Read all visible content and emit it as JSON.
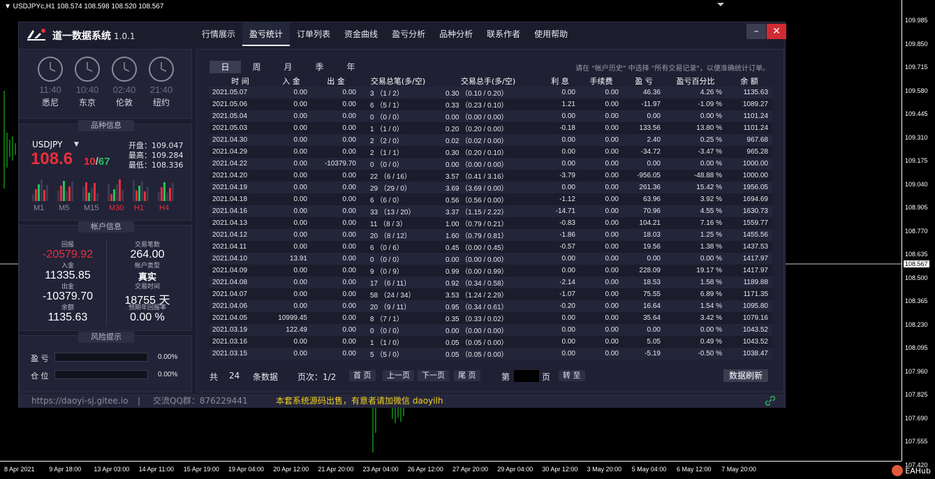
{
  "chart": {
    "symbol": "▼ USDJPYc,H1  108.574 108.598 108.520 108.567",
    "prices": [
      "109.985",
      "109.850",
      "109.715",
      "109.580",
      "109.445",
      "109.310",
      "109.175",
      "109.040",
      "108.905",
      "108.770",
      "108.635",
      "108.500",
      "108.365",
      "108.230",
      "108.095",
      "107.960",
      "107.825",
      "107.690",
      "107.555",
      "107.420"
    ],
    "current_price": "108.567",
    "times": [
      "8 Apr 2021",
      "9 Apr 18:00",
      "13 Apr 03:00",
      "14 Apr 11:00",
      "15 Apr 19:00",
      "19 Apr 04:00",
      "20 Apr 12:00",
      "21 Apr 20:00",
      "23 Apr 04:00",
      "26 Apr 12:00",
      "27 Apr 20:00",
      "29 Apr 04:00",
      "30 Apr 12:00",
      "3 May 20:00",
      "5 May 04:00",
      "6 May 12:00",
      "7 May 20:00"
    ],
    "watermark": "EAHub"
  },
  "app": {
    "title": "道一数据系统",
    "version": "1.0.1",
    "nav": [
      "行情展示",
      "盈亏统计",
      "订单列表",
      "资金曲线",
      "盈亏分析",
      "品种分析",
      "联系作者",
      "使用帮助"
    ],
    "min_label": "–",
    "close_label": "✕"
  },
  "clocks": [
    {
      "time": "11:40",
      "city": "悉尼"
    },
    {
      "time": "10:40",
      "city": "东京"
    },
    {
      "time": "02:40",
      "city": "伦敦"
    },
    {
      "time": "21:40",
      "city": "纽约"
    }
  ],
  "symbol": {
    "section_title": "品种信息",
    "name": "USDJPY",
    "price_main": "108.6",
    "price_frac_a": "10",
    "price_sep": "/",
    "price_frac_b": "67",
    "open": "开盘：109.047",
    "high": "最高：109.284",
    "low": "最低：108.336",
    "timeframes": [
      "M1",
      "M5",
      "M15",
      "M30",
      "H1",
      "H4"
    ]
  },
  "account": {
    "section_title": "帐户信息",
    "return_label": "回报",
    "return_value": "-20579.92",
    "trades_label": "交易笔数",
    "trades_value": "264.00",
    "deposit_label": "入金",
    "deposit_value": "11335.85",
    "type_label": "帐户类型",
    "type_value": "真实",
    "withdraw_label": "出金",
    "withdraw_value": "-10379.70",
    "time_label": "交易时间",
    "time_value": "18755 天",
    "balance_label": "余额",
    "balance_value": "1135.63",
    "annual_label": "预期年回报率",
    "annual_value": "0.00 %"
  },
  "risk": {
    "section_title": "风险提示",
    "pl_label": "盈 亏",
    "pl_value": "0.00%",
    "pos_label": "仓 位",
    "pos_value": "0.00%"
  },
  "stats": {
    "periods": [
      "日",
      "周",
      "月",
      "季",
      "年"
    ],
    "hint": "请在 \"帐户历史\" 中选择 \"所有交易记录\"，以便准确统计订单。",
    "headers": [
      "时 间",
      "入 金",
      "出 金",
      "交易总笔(多/空)",
      "交易总手(多/空)",
      "利 息",
      "手续费",
      "盈 亏",
      "盈亏百分比",
      "余 额"
    ],
    "rows": [
      {
        "date": "2021.05.07",
        "dep": "0.00",
        "wd": "0.00",
        "cnt": "3  （1 / 2）",
        "lots": "0.30  （0.10 / 0.20）",
        "swap": "0.00",
        "fee": "0.00",
        "pl": "46.36",
        "pct": "4.26 %",
        "bal": "1135.63",
        "sign": "pos"
      },
      {
        "date": "2021.05.06",
        "dep": "0.00",
        "wd": "0.00",
        "cnt": "6  （5 / 1）",
        "lots": "0.33  （0.23 / 0.10）",
        "swap": "1.21",
        "fee": "0.00",
        "pl": "-11.97",
        "pct": "-1.09 %",
        "bal": "1089.27",
        "sign": "neg"
      },
      {
        "date": "2021.05.04",
        "dep": "0.00",
        "wd": "0.00",
        "cnt": "0  （0 / 0）",
        "lots": "0.00  （0.00 / 0.00）",
        "swap": "0.00",
        "fee": "0.00",
        "pl": "0.00",
        "pct": "0.00 %",
        "bal": "1101.24",
        "sign": "zero"
      },
      {
        "date": "2021.05.03",
        "dep": "0.00",
        "wd": "0.00",
        "cnt": "1  （1 / 0）",
        "lots": "0.20  （0.20 / 0.00）",
        "swap": "-0.18",
        "fee": "0.00",
        "pl": "133.56",
        "pct": "13.80 %",
        "bal": "1101.24",
        "sign": "pos"
      },
      {
        "date": "2021.04.30",
        "dep": "0.00",
        "wd": "0.00",
        "cnt": "2  （2 / 0）",
        "lots": "0.02  （0.02 / 0.00）",
        "swap": "0.00",
        "fee": "0.00",
        "pl": "2.40",
        "pct": "0.25 %",
        "bal": "967.68",
        "sign": "pos"
      },
      {
        "date": "2021.04.29",
        "dep": "0.00",
        "wd": "0.00",
        "cnt": "2  （1 / 1）",
        "lots": "0.30  （0.20 / 0.10）",
        "swap": "0.00",
        "fee": "0.00",
        "pl": "-34.72",
        "pct": "-3.47 %",
        "bal": "965.28",
        "sign": "neg"
      },
      {
        "date": "2021.04.22",
        "dep": "0.00",
        "wd": "-10379.70",
        "cnt": "0  （0 / 0）",
        "lots": "0.00  （0.00 / 0.00）",
        "swap": "0.00",
        "fee": "0.00",
        "pl": "0.00",
        "pct": "0.00 %",
        "bal": "1000.00",
        "sign": "zero"
      },
      {
        "date": "2021.04.20",
        "dep": "0.00",
        "wd": "0.00",
        "cnt": "22  （6 / 16）",
        "lots": "3.57  （0.41 / 3.16）",
        "swap": "-3.79",
        "fee": "0.00",
        "pl": "-956.05",
        "pct": "-48.88 %",
        "bal": "1000.00",
        "sign": "neg"
      },
      {
        "date": "2021.04.19",
        "dep": "0.00",
        "wd": "0.00",
        "cnt": "29  （29 / 0）",
        "lots": "3.69  （3.69 / 0.00）",
        "swap": "0.00",
        "fee": "0.00",
        "pl": "261.36",
        "pct": "15.42 %",
        "bal": "1956.05",
        "sign": "pos"
      },
      {
        "date": "2021.04.18",
        "dep": "0.00",
        "wd": "0.00",
        "cnt": "6  （6 / 0）",
        "lots": "0.56  （0.56 / 0.00）",
        "swap": "-1.12",
        "fee": "0.00",
        "pl": "63.96",
        "pct": "3.92 %",
        "bal": "1694.69",
        "sign": "pos"
      },
      {
        "date": "2021.04.16",
        "dep": "0.00",
        "wd": "0.00",
        "cnt": "33  （13 / 20）",
        "lots": "3.37  （1.15 / 2.22）",
        "swap": "-14.71",
        "fee": "0.00",
        "pl": "70.96",
        "pct": "4.55 %",
        "bal": "1630.73",
        "sign": "pos"
      },
      {
        "date": "2021.04.13",
        "dep": "0.00",
        "wd": "0.00",
        "cnt": "11  （8 / 3）",
        "lots": "1.00  （0.79 / 0.21）",
        "swap": "-0.83",
        "fee": "0.00",
        "pl": "104.21",
        "pct": "7.16 %",
        "bal": "1559.77",
        "sign": "pos"
      },
      {
        "date": "2021.04.12",
        "dep": "0.00",
        "wd": "0.00",
        "cnt": "20  （8 / 12）",
        "lots": "1.60  （0.79 / 0.81）",
        "swap": "-1.86",
        "fee": "0.00",
        "pl": "18.03",
        "pct": "1.25 %",
        "bal": "1455.56",
        "sign": "pos"
      },
      {
        "date": "2021.04.11",
        "dep": "0.00",
        "wd": "0.00",
        "cnt": "6  （0 / 6）",
        "lots": "0.45  （0.00 / 0.45）",
        "swap": "-0.57",
        "fee": "0.00",
        "pl": "19.56",
        "pct": "1.38 %",
        "bal": "1437.53",
        "sign": "pos"
      },
      {
        "date": "2021.04.10",
        "dep": "13.91",
        "wd": "0.00",
        "cnt": "0  （0 / 0）",
        "lots": "0.00  （0.00 / 0.00）",
        "swap": "0.00",
        "fee": "0.00",
        "pl": "0.00",
        "pct": "0.00 %",
        "bal": "1417.97",
        "sign": "zero"
      },
      {
        "date": "2021.04.09",
        "dep": "0.00",
        "wd": "0.00",
        "cnt": "9  （0 / 9）",
        "lots": "0.99  （0.00 / 0.99）",
        "swap": "0.00",
        "fee": "0.00",
        "pl": "228.09",
        "pct": "19.17 %",
        "bal": "1417.97",
        "sign": "pos"
      },
      {
        "date": "2021.04.08",
        "dep": "0.00",
        "wd": "0.00",
        "cnt": "17  （6 / 11）",
        "lots": "0.92  （0.34 / 0.58）",
        "swap": "-2.14",
        "fee": "0.00",
        "pl": "18.53",
        "pct": "1.58 %",
        "bal": "1189.88",
        "sign": "pos"
      },
      {
        "date": "2021.04.07",
        "dep": "0.00",
        "wd": "0.00",
        "cnt": "58  （24 / 34）",
        "lots": "3.53  （1.24 / 2.29）",
        "swap": "-1.07",
        "fee": "0.00",
        "pl": "75.55",
        "pct": "6.89 %",
        "bal": "1171.35",
        "sign": "pos"
      },
      {
        "date": "2021.04.06",
        "dep": "0.00",
        "wd": "0.00",
        "cnt": "20  （9 / 11）",
        "lots": "0.95  （0.34 / 0.61）",
        "swap": "-0.20",
        "fee": "0.00",
        "pl": "16.64",
        "pct": "1.54 %",
        "bal": "1095.80",
        "sign": "pos"
      },
      {
        "date": "2021.04.05",
        "dep": "10999.45",
        "wd": "0.00",
        "cnt": "8  （7 / 1）",
        "lots": "0.35  （0.33 / 0.02）",
        "swap": "0.00",
        "fee": "0.00",
        "pl": "35.64",
        "pct": "3.42 %",
        "bal": "1079.16",
        "sign": "pos"
      },
      {
        "date": "2021.03.19",
        "dep": "122.49",
        "wd": "0.00",
        "cnt": "0  （0 / 0）",
        "lots": "0.00  （0.00 / 0.00）",
        "swap": "0.00",
        "fee": "0.00",
        "pl": "0.00",
        "pct": "0.00 %",
        "bal": "1043.52",
        "sign": "zero"
      },
      {
        "date": "2021.03.16",
        "dep": "0.00",
        "wd": "0.00",
        "cnt": "1  （1 / 0）",
        "lots": "0.05  （0.05 / 0.00）",
        "swap": "0.00",
        "fee": "0.00",
        "pl": "5.05",
        "pct": "0.49 %",
        "bal": "1043.52",
        "sign": "pos"
      },
      {
        "date": "2021.03.15",
        "dep": "0.00",
        "wd": "0.00",
        "cnt": "5  （5 / 0）",
        "lots": "0.05  （0.05 / 0.00）",
        "swap": "0.00",
        "fee": "0.00",
        "pl": "-5.19",
        "pct": "-0.50 %",
        "bal": "1038.47",
        "sign": "neg"
      }
    ]
  },
  "pager": {
    "total_prefix": "共",
    "total": "24",
    "total_suffix": "条数据",
    "page_info": "页次：1/2",
    "first": "首 页",
    "prev": "上一页",
    "next": "下一页",
    "last": "尾 页",
    "goto_prefix": "第",
    "goto_suffix": "页",
    "goto_btn": "转 至",
    "refresh": "数据刷新"
  },
  "status": {
    "url": "https://daoyi-sj.gitee.io",
    "sep": "|",
    "qq": "交流QQ群：876229441",
    "message": "本套系统源码出售，有意者请加微信 daoyilh"
  },
  "colors": {
    "accent_red": "#e8303a",
    "accent_green": "#2ab35a",
    "date_orange": "#e5a82a",
    "panel_bg": "#1b1c2c"
  }
}
